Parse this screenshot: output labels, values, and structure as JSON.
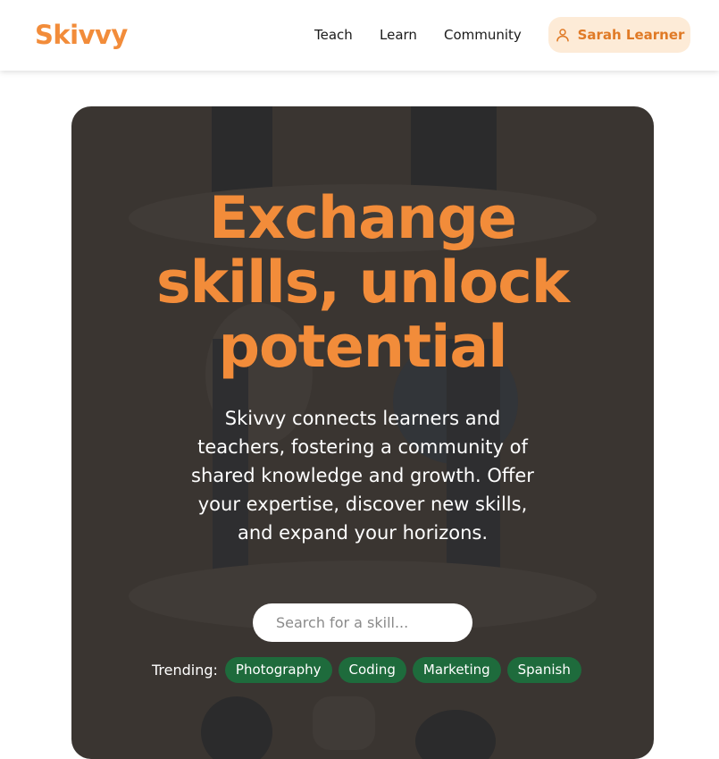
{
  "header": {
    "logo": "Skivvy",
    "nav": [
      "Teach",
      "Learn",
      "Community"
    ],
    "user_label": "Sarah Learner",
    "user_icon": "user-icon"
  },
  "hero": {
    "title_lines": [
      "Exchange",
      "skills, unlock",
      "potential"
    ],
    "description": "Skivvy connects learners and teachers, fostering a community of shared knowledge and growth. Offer your expertise, discover new skills, and expand your horizons.",
    "search_placeholder": "Search for a skill...",
    "trending_label": "Trending:",
    "trending_tags": [
      "Photography",
      "Coding",
      "Marketing",
      "Spanish"
    ]
  },
  "colors": {
    "brand": "#f28c3a",
    "hero_bg": "#3a3531",
    "tag_bg": "#1e6b3c",
    "user_btn_bg": "#fdebd7"
  }
}
